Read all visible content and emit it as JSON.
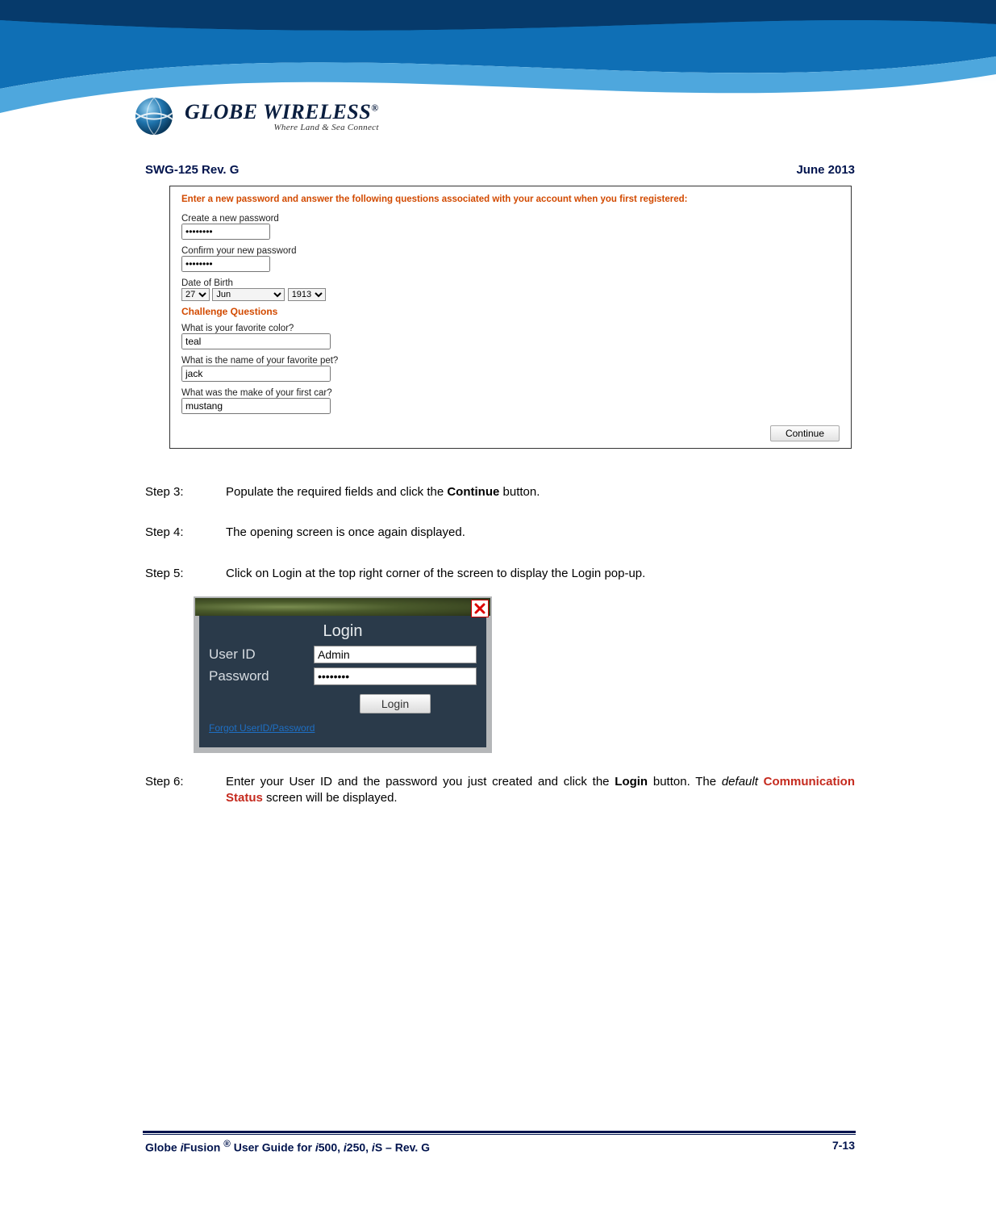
{
  "header": {
    "doc_rev": "SWG-125 Rev. G",
    "date": "June 2013"
  },
  "logo": {
    "brand": "GLOBE WIRELESS",
    "reg": "®",
    "tagline": "Where Land & Sea Connect"
  },
  "panel1": {
    "instruction": "Enter a new password and answer the following questions associated with your account when you first registered:",
    "create_label": "Create a new password",
    "create_value": "••••••••",
    "confirm_label": "Confirm your new password",
    "confirm_value": "••••••••",
    "dob_label": "Date of Birth",
    "dob_day": "27",
    "dob_month": "Jun",
    "dob_year": "1913",
    "cq_title": "Challenge Questions",
    "q1_label": "What is your favorite color?",
    "q1_value": "teal",
    "q2_label": "What is the name of your favorite pet?",
    "q2_value": "jack",
    "q3_label": "What was the make of your first car?",
    "q3_value": "mustang",
    "continue_label": "Continue"
  },
  "steps": {
    "s3_label": "Step  3:",
    "s3_a": "Populate the required fields and click the ",
    "s3_b": "Continue",
    "s3_c": " button.",
    "s4_label": "Step  4:",
    "s4_a": "The opening screen is once again displayed.",
    "s5_label": "Step  5:",
    "s5_a": "Click on Login at the top right corner of the screen to display the Login pop-up.",
    "s6_label": "Step  6:",
    "s6_a": "Enter your User ID and the password you just created and click the ",
    "s6_b": "Login",
    "s6_c": " button. The ",
    "s6_d": "default",
    "s6_e": " ",
    "s6_f": "Communication Status",
    "s6_g": " screen will be displayed."
  },
  "login_popup": {
    "title": "Login",
    "userid_label": "User ID",
    "userid_value": "Admin",
    "password_label": "Password",
    "password_value": "••••••••",
    "login_btn": "Login",
    "forgot": "Forgot UserID/Password"
  },
  "footer": {
    "left_a": "Globe ",
    "left_b": "i",
    "left_c": "Fusion ",
    "left_d": "®",
    "left_e": " User Guide for ",
    "left_f": "i",
    "left_g": "500, ",
    "left_h": "i",
    "left_i": "250, ",
    "left_j": "i",
    "left_k": "S – Rev. G",
    "page": "7-13"
  }
}
